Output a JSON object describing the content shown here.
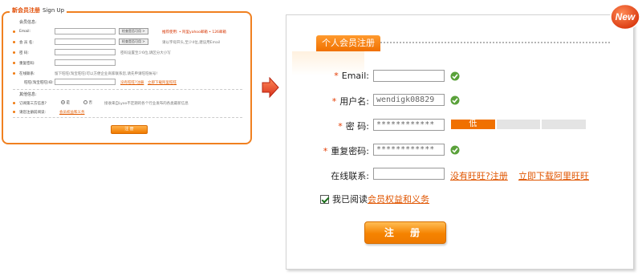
{
  "old_form": {
    "title_cn": "新会员注册",
    "title_en": "Sign Up",
    "section_member": "会员信息:",
    "rows": [
      {
        "label": "Email:",
        "check": "检查是否可用 >",
        "hint": "推荐使用: • 阿里yahoo邮箱 • 126邮箱",
        "hint_red": true
      },
      {
        "label": "会 员 名:",
        "check": "检查是否可用 >",
        "hint": "请以字母开头,至少4位,建议用Email",
        "hint_red": false
      },
      {
        "label": "密  码:",
        "check": "",
        "hint": "密码设置至少6位,请区分大小写",
        "hint_red": false
      },
      {
        "label": "重复密码:",
        "check": "",
        "hint": "",
        "hint_red": false
      },
      {
        "label": "在线联系:",
        "check": "",
        "hint": "留下旺旺(淘宝旺旺)可以方便企业商家联系您,请先申请旺旺帐号!",
        "hint_red": false
      },
      {
        "label": "旺旺(淘宝旺旺)ID:",
        "check": "",
        "hint": "没有旺旺?注册",
        "hint2": "立即下载阿里旺旺",
        "hint_red": true
      }
    ],
    "section_other": "其他信息:",
    "subscribe_label": "订阅第三方信息?",
    "subscribe_yes": "是",
    "subscribe_no": "否",
    "subscribe_hint": "接收来自Lyoo不定期的各个行业发布的各类最新信息",
    "terms_label": "请您注册前阅读:",
    "terms_link": "会员权益和义务",
    "submit": "注 册"
  },
  "new_form": {
    "badge": "New",
    "tab_title": "个人会员注册",
    "email_label": "Email:",
    "email_value": "",
    "username_label": "用户名:",
    "username_value": "wendigk08829",
    "password_label": "密  码:",
    "password_value": "************",
    "strength_levels": [
      "低",
      "",
      ""
    ],
    "strength_active": 0,
    "confirm_label": "重复密码:",
    "confirm_value": "************",
    "contact_label": "在线联系:",
    "contact_value": "",
    "no_wangwang_link": "没有旺旺?注册",
    "download_link": "立即下载阿里旺旺",
    "agree_text": "我已阅读",
    "agree_link": "会员权益和义务",
    "agree_checked": true,
    "submit": "注 册"
  },
  "colors": {
    "accent": "#f07a00",
    "link": "#e05500",
    "required": "#e43a00",
    "ok_green": "#4a9a2a",
    "badge_red": "#e0380a"
  }
}
